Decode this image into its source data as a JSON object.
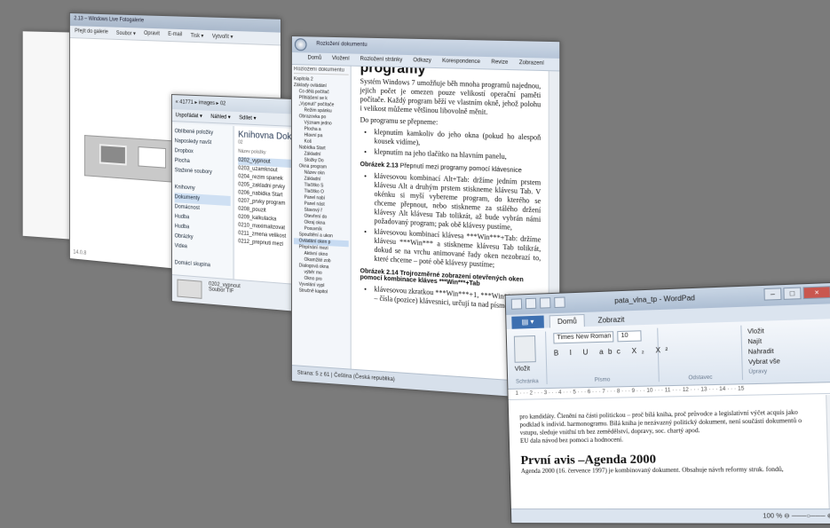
{
  "ie": {
    "title": "2.13 – Windows Live Fotogalerie",
    "toolbar": [
      "Přejít do galerie",
      "Soubor ▾",
      "Opravit",
      "E-mail",
      "Tisk ▾",
      "Vytvořit ▾"
    ],
    "footer": "14.0.8"
  },
  "explorer": {
    "address": "« 41771 ▸ images ▸ 02",
    "toolbar": [
      "Uspořádat ▾",
      "Náhled ▾",
      "Sdílet ▾"
    ],
    "nav_items": [
      "Oblíbené položky",
      "Naposledy navšt",
      "Dropbox",
      "Plocha",
      "Stažené soubory",
      "",
      "Knihovny",
      "Dokumenty",
      "Domácnost",
      "Hudba",
      "Hudba",
      "Obrázky",
      "Videa",
      "",
      "Domácí skupina"
    ],
    "library_title": "Knihovna Doku",
    "library_sub": "02",
    "col_caption": "Název položky",
    "files": [
      "0202_vypnout",
      "0203_uzamknout",
      "0204_rezim spanek",
      "0205_zakladni prvky",
      "0206_nabidka Start",
      "0207_prvky program",
      "0208_pouzit",
      "0209_kalkulacka",
      "0210_maximalizovat",
      "0211_zmena velikost",
      "0212_prepnuti mezi"
    ],
    "status_name": "0202_vypnout",
    "status_type": "Soubor TIF",
    "status_label2": "Naposledy"
  },
  "word": {
    "title": "Rozložení dokumentu",
    "ribbon": [
      "Domů",
      "Vložení",
      "Rozložení stránky",
      "Odkazy",
      "Korespondence",
      "Revize",
      "Zobrazení"
    ],
    "nav_header": "Rozložení dokumentu",
    "nav_items": [
      "Kapitola 2",
      "Základy ovládání",
      "Co dělá počítač",
      "Přihlášení se k",
      "„Vypnutí“ počítače",
      "Režim spánku",
      "Obrazovka po",
      "Význam jedno",
      "Plocha a",
      "Hlavní pa",
      "Koš",
      "Nabídka Start",
      "Základní",
      "Složky Do",
      "Okna program",
      "Název okn",
      "Základní",
      "Tlačítko S",
      "Tlačítko O",
      "Panel nabí",
      "Panel nást",
      "Stavový ř",
      "Otevření do",
      "Okraj okna",
      "Posuvník",
      "Spouštění a ukon",
      "Ovládání oken p",
      "Přepínání mezi",
      "Aktivní okno",
      "Okamžité zob",
      "Dialogová okna",
      "výběr mo",
      "Okno pro",
      "Vyvolání vypl",
      "Stručně kapitol"
    ],
    "heading": "programy",
    "p1": "Systém Windows 7 umožňuje běh mnoha programů najednou, jejich počet je omezen pouze velikostí operační paměti počítače. Každý program běží ve vlastním okně, jehož polohu i velikost můžeme většinou libovolně měnit.",
    "p2": "Do programu se přepneme:",
    "b1": "klepnutím kamkoliv do jeho okna (pokud ho alespoň kousek vidíme),",
    "b2": "klepnutím na jeho tlačítko na hlavním panelu,",
    "fig1_num": "Obrázek 2.13",
    "fig1_text": "Přepnutí mezi programy pomocí klávesnice",
    "b3": "klávesovou kombinací Alt+Tab: držíme jedním prstem klávesu Alt a druhým prstem stiskneme klávesu Tab. V okénku si myší vybereme program, do kterého se chceme přepnout, nebo stiskneme za stálého držení klávesy Alt klávesu Tab tolikrát, až bude vybrán námi požadovaný program; pak obě klávesy pustíme,",
    "b4": "klávesovou kombinací klávesa ***Win***+Tab: držíme klávesu ***Win*** a stiskneme klávesu Tab tolikrát, dokud se na vrchu animované řady oken nezobrazí to, které chceme – poté obě klávesy pustíme;",
    "fig2_num": "Obrázek 2.14",
    "fig2_text": "Trojrozměrné zobrazení otevřených oken pomocí kombinace kláves ***Win***+Tab",
    "b5": "klávesovou zkratkou ***Win***+1, ***Win***+2 apod. – čísla (pozice) klávesnici, určují ta nad písmeny",
    "status": "Strana: 5 z 61 | Čeština (Česká republika)"
  },
  "wordpad": {
    "title": "pata_vlna_tp - WordPad",
    "menu": "▤ ▾",
    "tab_home": "Domů",
    "tab_view": "Zobrazit",
    "paste": "Vložit",
    "clipboard": "Schránka",
    "font": "Times New Roman",
    "size": "10",
    "font_group": "Písmo",
    "format": "B I U abc X₂ X²",
    "para_group": "Odstavec",
    "insert": "Vložit",
    "find": "Najít",
    "replace": "Nahradit",
    "select_all": "Vybrat vše",
    "edit_group": "Úpravy",
    "ruler": "1 · · · 2 · · · 3 · · · 4 · · · 5 · · · 6 · · · 7 · · · 8 · · · 9 · · · 10 · · · 11 · · · 12 · · · 13 · · · 14 · · · 15",
    "p1": "pro kandidáty. Členění na části politickou – proč bílá kniha, proč průvodce a legislativní výčet acquis jako podklad k individ. harmonogramu. Bílá kniha je nezávazný politický dokument, není součástí dokumentů o vstupu, sleduje vnitřní trh bez zemědělství, dopravy, soc. chartý apod.",
    "p2": "EU dala návod bez pomoci a hodnocení.",
    "heading": "První avis –Agenda 2000",
    "p3": "Agenda 2000 (16. července 1997) je kombinovaný dokument. Obsahuje návrh reformy struk. fondů,",
    "zoom": "100 %"
  }
}
